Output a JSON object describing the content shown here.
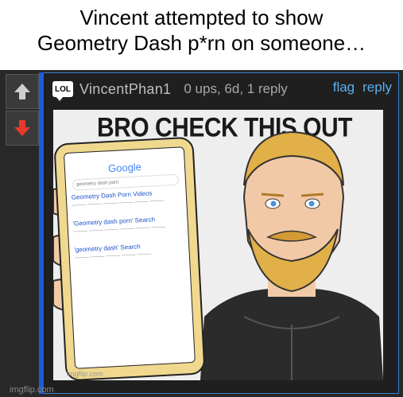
{
  "caption": {
    "line1": "Vincent attempted to show",
    "line2": "Geometry Dash p*rn on someone…"
  },
  "comment": {
    "icon": "LOL",
    "username": "VincentPhan1",
    "meta": "0 ups, 6d, 1 reply",
    "flag_label": "flag",
    "reply_label": "reply"
  },
  "meme": {
    "top_text": "BRO CHECK THIS OUT",
    "search_query": "geometry dash porn",
    "results": [
      {
        "title": "Geometry Dash Porn Videos"
      },
      {
        "title": "'Geometry dash porn' Search"
      },
      {
        "title": "'geometry dash' Search"
      }
    ],
    "inner_watermark": "imgflip.com"
  },
  "watermark": "imgflip.com",
  "colors": {
    "accent": "#1e5bd6",
    "link": "#5ab0f0",
    "upvote": "#cfcfcf",
    "downvote": "#e83a2c"
  }
}
